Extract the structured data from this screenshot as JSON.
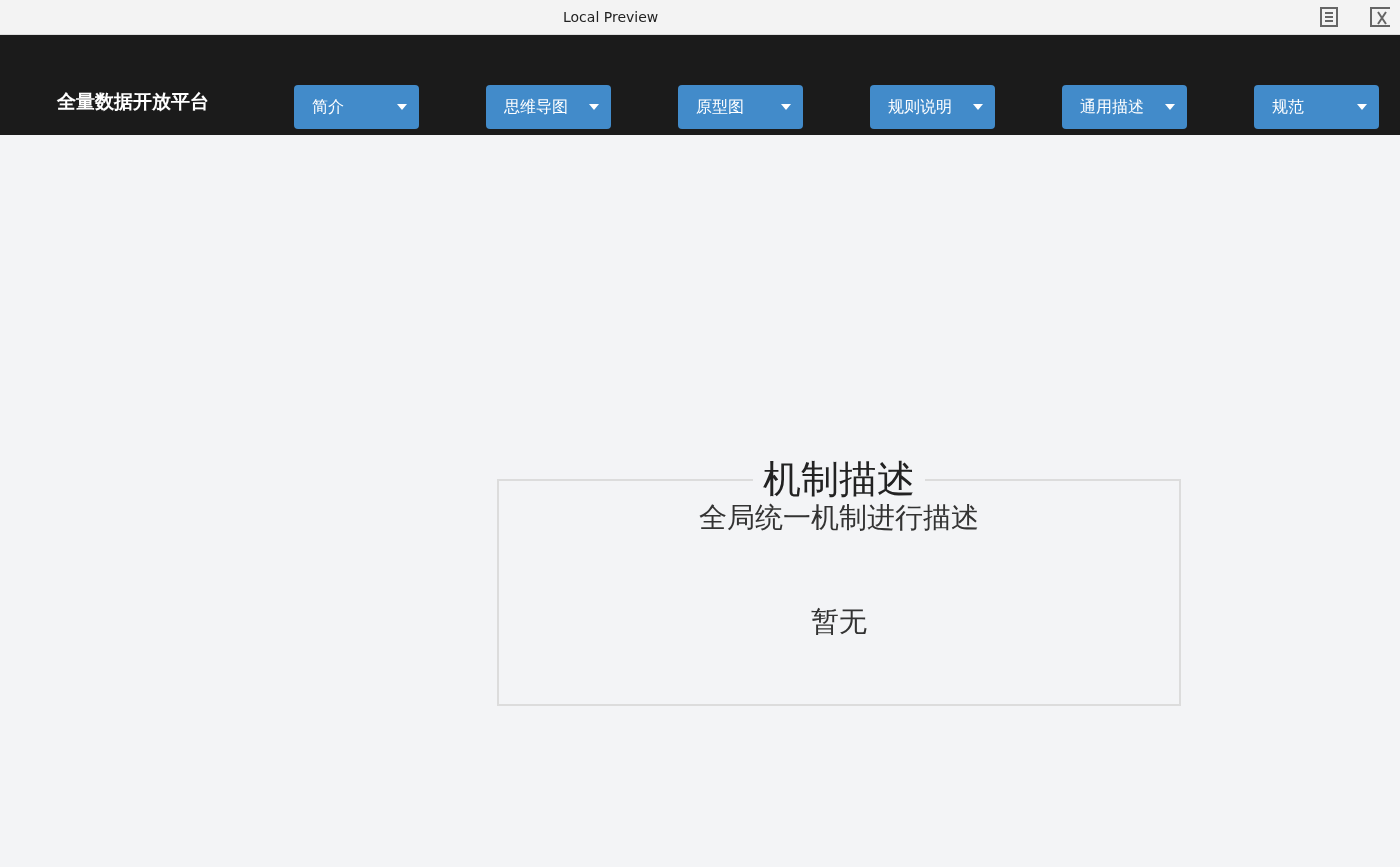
{
  "window": {
    "title": "Local Preview"
  },
  "navbar": {
    "brand": "全量数据开放平台",
    "menus": [
      {
        "label": "简介"
      },
      {
        "label": "思维导图"
      },
      {
        "label": "原型图"
      },
      {
        "label": "规则说明"
      },
      {
        "label": "通用描述"
      },
      {
        "label": "规范"
      }
    ]
  },
  "section": {
    "title": "机制描述",
    "subtitle": "全局统一机制进行描述",
    "body": "暂无"
  }
}
